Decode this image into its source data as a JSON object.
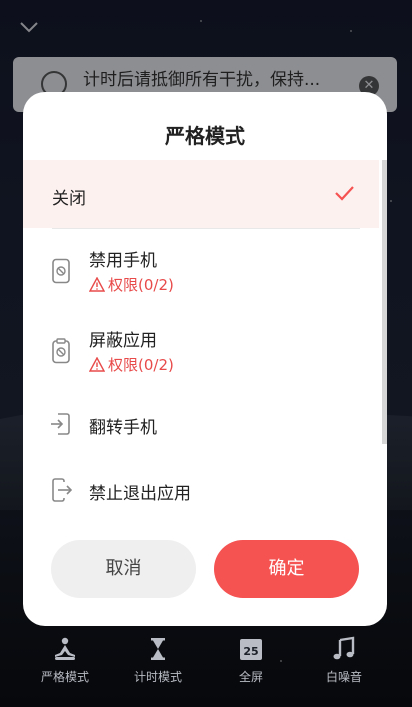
{
  "background": {
    "tip_text": "计时后请抵御所有干扰，保持..."
  },
  "dialog": {
    "title": "严格模式",
    "options": [
      {
        "label": "关闭",
        "selected": true,
        "icon": "check-icon"
      },
      {
        "label": "禁用手机",
        "warning": "权限(0/2)",
        "icon": "phone-lock-icon"
      },
      {
        "label": "屏蔽应用",
        "warning": "权限(0/2)",
        "icon": "app-block-icon"
      },
      {
        "label": "翻转手机",
        "icon": "flip-phone-icon"
      },
      {
        "label": "禁止退出应用",
        "icon": "exit-app-icon"
      }
    ],
    "cancel_label": "取消",
    "confirm_label": "确定"
  },
  "bottom_nav": [
    {
      "label": "严格模式",
      "icon": "meditation-icon"
    },
    {
      "label": "计时模式",
      "icon": "hourglass-icon"
    },
    {
      "label": "全屏",
      "icon": "calendar-icon",
      "icon_text": "25"
    },
    {
      "label": "白噪音",
      "icon": "music-note-icon"
    }
  ],
  "colors": {
    "accent": "#f55252",
    "warning": "#e84a4a",
    "selected_row": "#fdf1ef"
  }
}
